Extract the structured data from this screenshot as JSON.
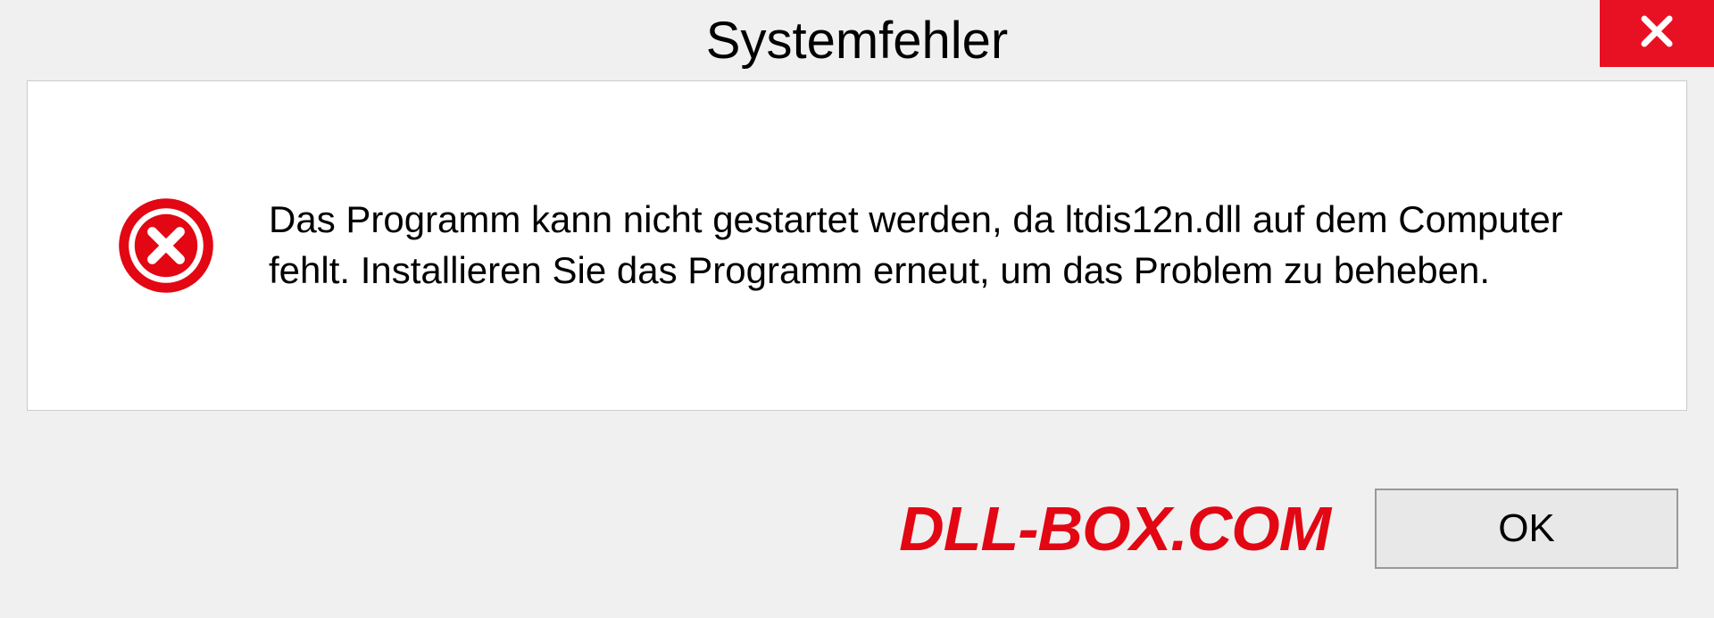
{
  "dialog": {
    "title": "Systemfehler",
    "message": "Das Programm kann nicht gestartet werden, da ltdis12n.dll auf dem Computer fehlt. Installieren Sie das Programm erneut, um das Problem zu beheben.",
    "ok_label": "OK"
  },
  "watermark": "DLL-BOX.COM",
  "colors": {
    "close_bg": "#e81123",
    "error_icon": "#e30613",
    "watermark": "#e30613"
  }
}
